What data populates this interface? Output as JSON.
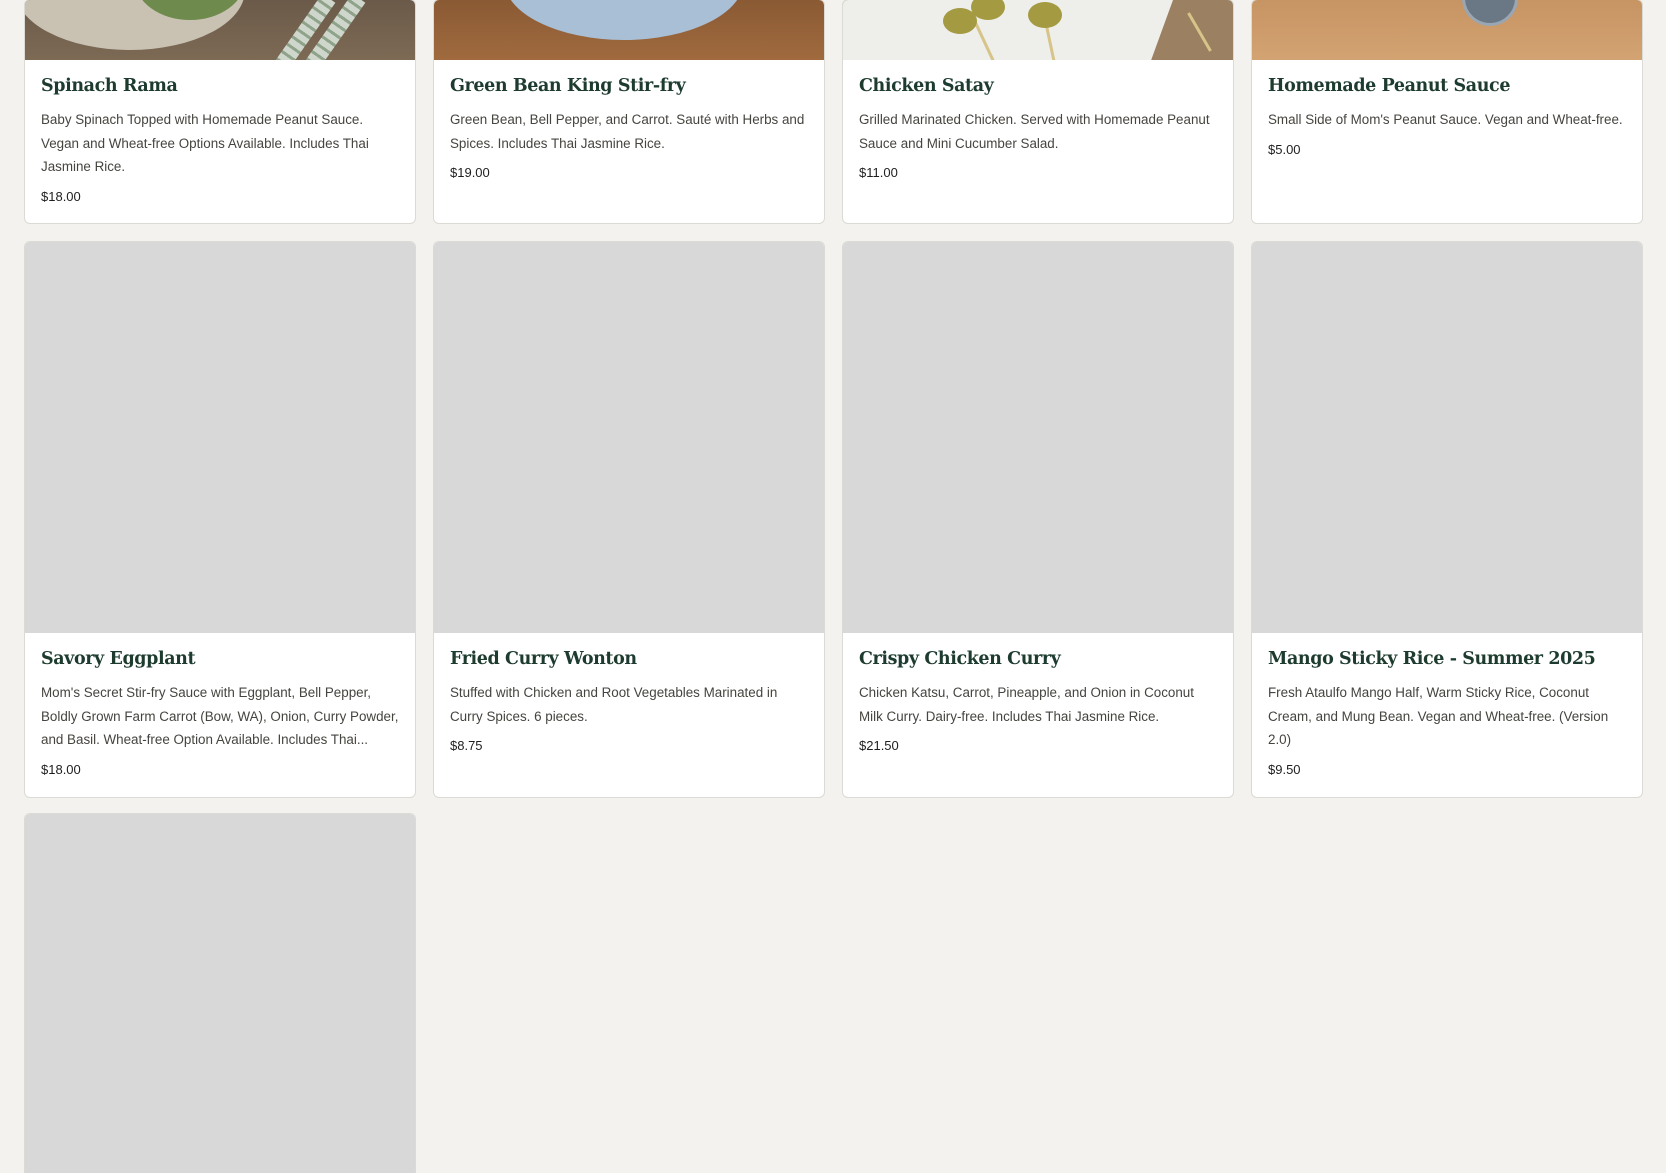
{
  "menu": {
    "items": [
      {
        "name": "Spinach Rama",
        "description": "Baby Spinach Topped with Homemade Peanut Sauce. Vegan and Wheat-free Options Available. Includes Thai Jasmine Rice.",
        "price": "$18.00"
      },
      {
        "name": "Green Bean King Stir-fry",
        "description": "Green Bean, Bell Pepper, and Carrot. Sauté with Herbs and Spices. Includes Thai Jasmine Rice.",
        "price": "$19.00"
      },
      {
        "name": "Chicken Satay",
        "description": "Grilled Marinated Chicken. Served with Homemade Peanut Sauce and Mini Cucumber Salad.",
        "price": "$11.00"
      },
      {
        "name": "Homemade Peanut Sauce",
        "description": "Small Side of Mom's Peanut Sauce. Vegan and Wheat-free.",
        "price": "$5.00"
      },
      {
        "name": "Savory Eggplant",
        "description": "Mom's Secret Stir-fry Sauce with Eggplant, Bell Pepper, Boldly Grown Farm Carrot (Bow, WA), Onion, Curry Powder, and Basil. Wheat-free Option Available. Includes Thai...",
        "price": "$18.00"
      },
      {
        "name": "Fried Curry Wonton",
        "description": "Stuffed with Chicken and Root Vegetables Marinated in Curry Spices. 6 pieces.",
        "price": "$8.75"
      },
      {
        "name": "Crispy Chicken Curry",
        "description": "Chicken Katsu, Carrot, Pineapple, and Onion in Coconut Milk Curry. Dairy-free. Includes Thai Jasmine Rice.",
        "price": "$21.50"
      },
      {
        "name": "Mango Sticky Rice - Summer 2025",
        "description": "Fresh Ataulfo Mango Half, Warm Sticky Rice, Coconut Cream, and Mung Bean. Vegan and Wheat-free. (Version 2.0)",
        "price": "$9.50"
      }
    ]
  },
  "colors": {
    "page_background": "#f3f2ee",
    "card_background": "#ffffff",
    "title": "#1d3b2e",
    "image_placeholder": "#d8d8d8"
  }
}
